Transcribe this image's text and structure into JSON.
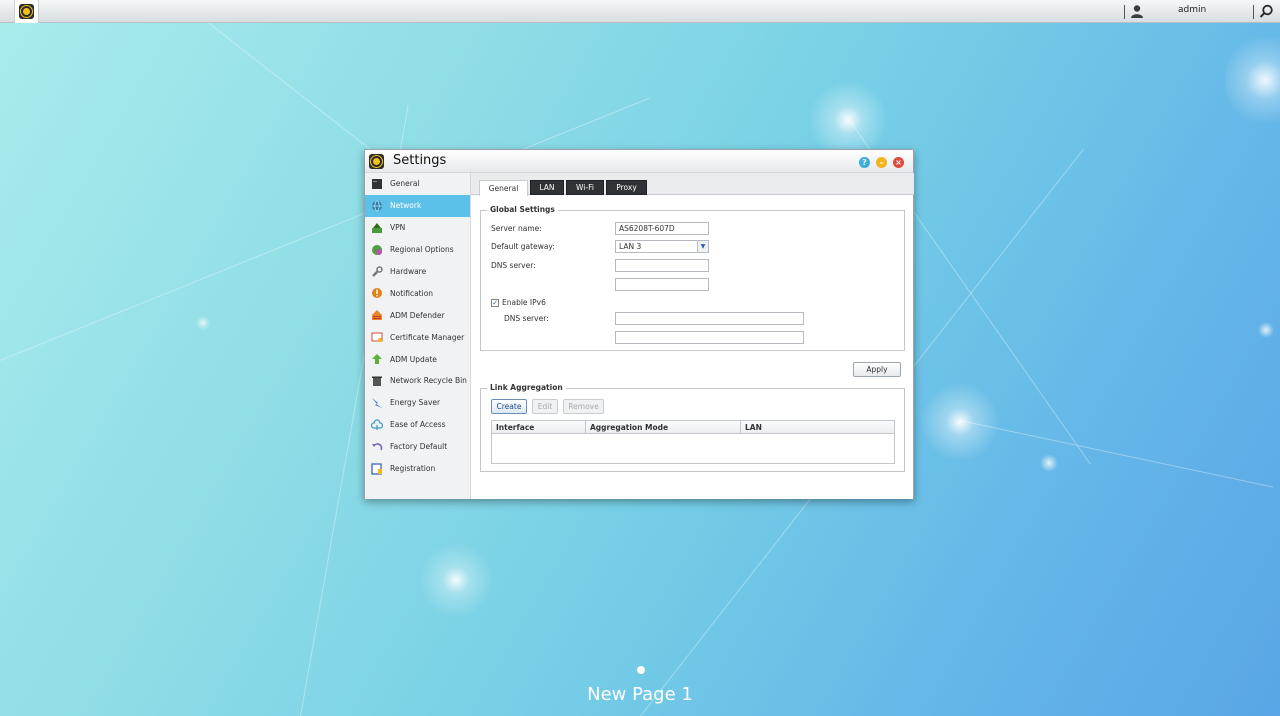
{
  "topbar": {
    "user": "admin"
  },
  "window": {
    "title": "Settings",
    "sidebar": [
      {
        "label": "General",
        "icon": "server-icon"
      },
      {
        "label": "Network",
        "icon": "globe-icon"
      },
      {
        "label": "VPN",
        "icon": "vpn-icon"
      },
      {
        "label": "Regional Options",
        "icon": "regional-icon"
      },
      {
        "label": "Hardware",
        "icon": "wrench-icon"
      },
      {
        "label": "Notification",
        "icon": "alert-icon"
      },
      {
        "label": "ADM Defender",
        "icon": "firewall-icon"
      },
      {
        "label": "Certificate Manager",
        "icon": "certificate-icon"
      },
      {
        "label": "ADM Update",
        "icon": "update-arrow-icon"
      },
      {
        "label": "Network Recycle Bin",
        "icon": "trash-icon"
      },
      {
        "label": "Energy Saver",
        "icon": "energy-icon"
      },
      {
        "label": "Ease of Access",
        "icon": "cloud-icon"
      },
      {
        "label": "Factory Default",
        "icon": "reset-icon"
      },
      {
        "label": "Registration",
        "icon": "registration-icon"
      }
    ],
    "active_sidebar": "Network",
    "tabs": [
      "General",
      "LAN",
      "Wi-Fi",
      "Proxy"
    ],
    "active_tab": "General",
    "global": {
      "legend": "Global Settings",
      "server_name_label": "Server name:",
      "server_name_value": "AS6208T-607D",
      "gateway_label": "Default gateway:",
      "gateway_value": "LAN 3",
      "dns_label": "DNS server:",
      "dns1": "",
      "dns2": "",
      "ipv6_label": "Enable IPv6",
      "ipv6_checked": true,
      "ipv6_dns_label": "DNS server:",
      "ipv6_dns1": "",
      "ipv6_dns2": ""
    },
    "apply_label": "Apply",
    "link_agg": {
      "legend": "Link Aggregation",
      "create": "Create",
      "edit": "Edit",
      "remove": "Remove",
      "columns": [
        "Interface",
        "Aggregation Mode",
        "LAN"
      ]
    }
  },
  "page_label": "New Page 1",
  "colors": {
    "accent": "#5dc0e8",
    "close": "#e04a3b",
    "minimize": "#f2b51f",
    "help": "#3aaed8"
  }
}
